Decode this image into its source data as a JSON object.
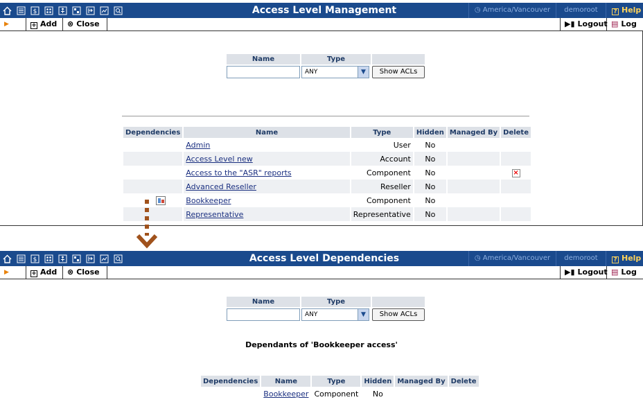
{
  "icons": [
    "home-icon",
    "list-icon",
    "dollar-icon",
    "grid-icon",
    "person-icon",
    "network-icon",
    "export-icon",
    "chart-icon",
    "search-icon"
  ],
  "panel_top": {
    "title": "Access Level Management",
    "timezone": "America/Vancouver",
    "user": "demoroot",
    "help": "Help",
    "toolbar": {
      "add": "Add",
      "close": "Close",
      "logout": "Logout",
      "log": "Log"
    },
    "filter": {
      "name_header": "Name",
      "type_header": "Type",
      "name_value": "",
      "type_value": "ANY",
      "button": "Show ACLs"
    },
    "table": {
      "headers": [
        "Dependencies",
        "Name",
        "Type",
        "Hidden",
        "Managed By",
        "Delete"
      ],
      "rows": [
        {
          "name": "Admin",
          "type": "User",
          "hidden": "No"
        },
        {
          "name": "Access Level new",
          "type": "Account",
          "hidden": "No"
        },
        {
          "name": "Access to the \"ASR\" reports",
          "type": "Component",
          "hidden": "No"
        },
        {
          "name": "Advanced Reseller",
          "type": "Reseller",
          "hidden": "No"
        },
        {
          "name": "Bookkeeper",
          "type": "Component",
          "hidden": "No"
        },
        {
          "name": "Representative",
          "type": "Representative",
          "hidden": "No"
        }
      ]
    }
  },
  "panel_bottom": {
    "title": "Access Level Dependencies",
    "timezone": "America/Vancouver",
    "user": "demoroot",
    "help": "Help",
    "toolbar": {
      "add": "Add",
      "close": "Close",
      "logout": "Logout",
      "log": "Log"
    },
    "filter": {
      "name_header": "Name",
      "type_header": "Type",
      "name_value": "",
      "type_value": "ANY",
      "button": "Show ACLs"
    },
    "caption": "Dependants of 'Bookkeeper access'",
    "table": {
      "headers": [
        "Dependencies",
        "Name",
        "Type",
        "Hidden",
        "Managed By",
        "Delete"
      ],
      "rows": [
        {
          "name": "Bookkeeper",
          "type": "Component",
          "hidden": "No"
        }
      ]
    }
  },
  "colors": {
    "topbar": "#1a4a8d",
    "header_cell": "#dde1e7",
    "connector": "#a0521c",
    "help": "#ffd35a"
  }
}
